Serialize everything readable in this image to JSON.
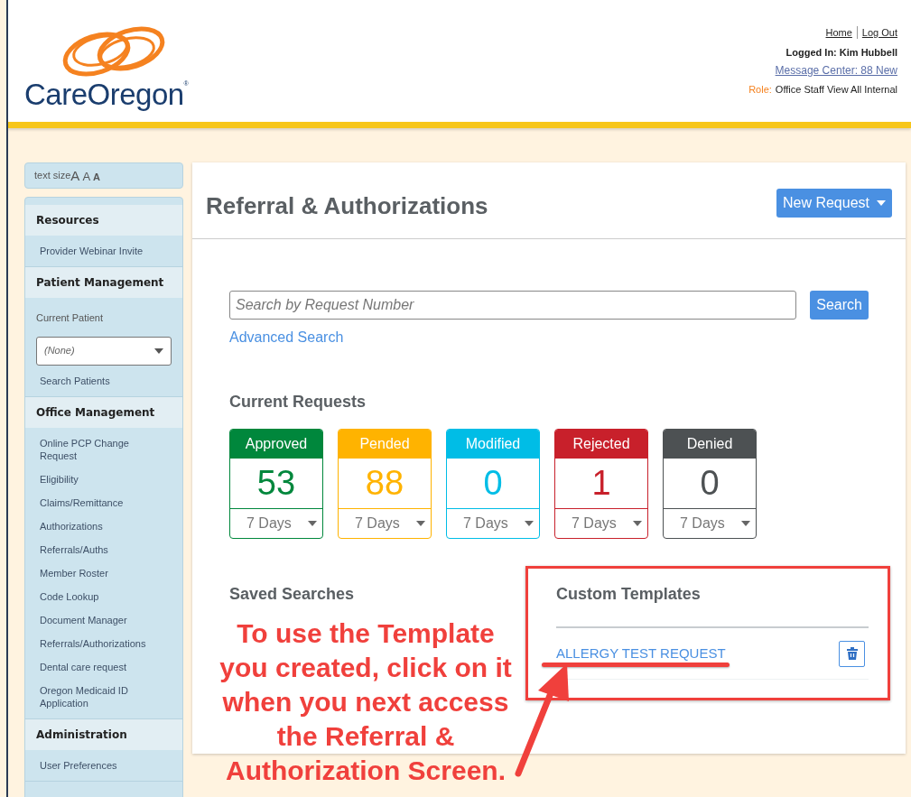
{
  "header": {
    "logo_text": "CareOregon",
    "logo_mark": "®",
    "links": [
      {
        "label": "Home"
      },
      {
        "label": "Log Out"
      }
    ],
    "logged_in": "Logged In: Kim Hubbell",
    "message_center": "Message Center: 88 New",
    "role_label": "Role:",
    "role_value": "Office Staff View All Internal"
  },
  "text_size": {
    "label": "text size",
    "sizes": [
      "A",
      "A",
      "A"
    ]
  },
  "sidebar": {
    "sections": [
      {
        "title": "Resources",
        "items": [
          {
            "kind": "link",
            "label": "Provider Webinar Invite"
          }
        ]
      },
      {
        "title": "Patient Management",
        "items": [
          {
            "kind": "label",
            "label": "Current Patient"
          },
          {
            "kind": "select",
            "label": "(None)"
          },
          {
            "kind": "link",
            "label": "Search Patients"
          }
        ]
      },
      {
        "title": "Office Management",
        "items": [
          {
            "kind": "link",
            "label": "Online PCP Change Request"
          },
          {
            "kind": "link",
            "label": "Eligibility"
          },
          {
            "kind": "link",
            "label": "Claims/Remittance"
          },
          {
            "kind": "link",
            "label": "Authorizations"
          },
          {
            "kind": "link",
            "label": "Referrals/Auths"
          },
          {
            "kind": "link",
            "label": "Member Roster"
          },
          {
            "kind": "link",
            "label": "Code Lookup"
          },
          {
            "kind": "link",
            "label": "Document Manager"
          },
          {
            "kind": "link",
            "label": "Referrals/Authorizations"
          },
          {
            "kind": "link",
            "label": "Dental care request"
          },
          {
            "kind": "link",
            "label": "Oregon Medicaid ID Application"
          }
        ]
      },
      {
        "title": "Administration",
        "items": [
          {
            "kind": "link",
            "label": "User Preferences"
          }
        ]
      }
    ]
  },
  "main": {
    "title": "Referral & Authorizations",
    "new_request": "New Request",
    "search": {
      "placeholder": "Search by Request Number",
      "button": "Search",
      "advanced": "Advanced Search"
    },
    "current_requests": {
      "title": "Current Requests",
      "cards": [
        {
          "label": "Approved",
          "count": "53",
          "period": "7 Days",
          "color": "#00873c"
        },
        {
          "label": "Pended",
          "count": "88",
          "period": "7 Days",
          "color": "#ffb300"
        },
        {
          "label": "Modified",
          "count": "0",
          "period": "7 Days",
          "color": "#00bde6"
        },
        {
          "label": "Rejected",
          "count": "1",
          "period": "7 Days",
          "color": "#c8202b"
        },
        {
          "label": "Denied",
          "count": "0",
          "period": "7 Days",
          "color": "#4d5153"
        }
      ]
    },
    "saved_searches": {
      "title": "Saved Searches"
    },
    "custom_templates": {
      "title": "Custom Templates",
      "items": [
        {
          "label": "ALLERGY TEST REQUEST"
        }
      ]
    }
  },
  "annotation": {
    "text": "To use the Template you created, click on it when you next access the Referral & Authorization Screen."
  }
}
